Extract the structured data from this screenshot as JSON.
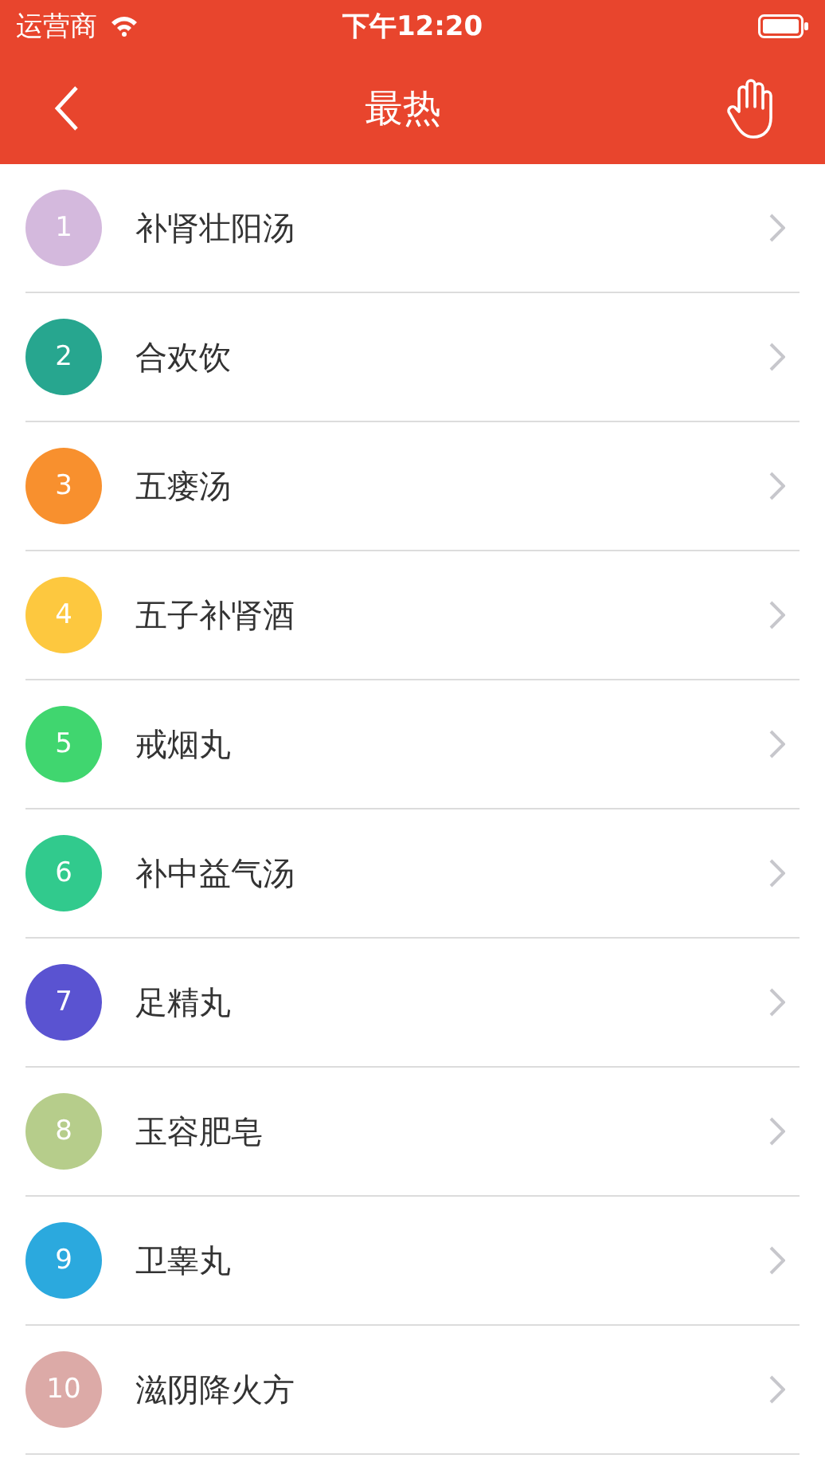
{
  "status_bar": {
    "carrier": "运营商",
    "time": "下午12:20"
  },
  "header": {
    "title": "最热"
  },
  "items": [
    {
      "rank": "1",
      "name": "补肾壮阳汤",
      "color": "#d4b9dd"
    },
    {
      "rank": "2",
      "name": "合欢饮",
      "color": "#27a68f"
    },
    {
      "rank": "3",
      "name": "五瘘汤",
      "color": "#f8902e"
    },
    {
      "rank": "4",
      "name": "五子补肾酒",
      "color": "#fdc83f"
    },
    {
      "rank": "5",
      "name": "戒烟丸",
      "color": "#40d66f"
    },
    {
      "rank": "6",
      "name": "补中益气汤",
      "color": "#31ca8d"
    },
    {
      "rank": "7",
      "name": "足精丸",
      "color": "#5a53d1"
    },
    {
      "rank": "8",
      "name": "玉容肥皂",
      "color": "#b6cd8b"
    },
    {
      "rank": "9",
      "name": "卫睾丸",
      "color": "#2ba9de"
    },
    {
      "rank": "10",
      "name": "滋阴降火方",
      "color": "#dcaaa7"
    }
  ]
}
